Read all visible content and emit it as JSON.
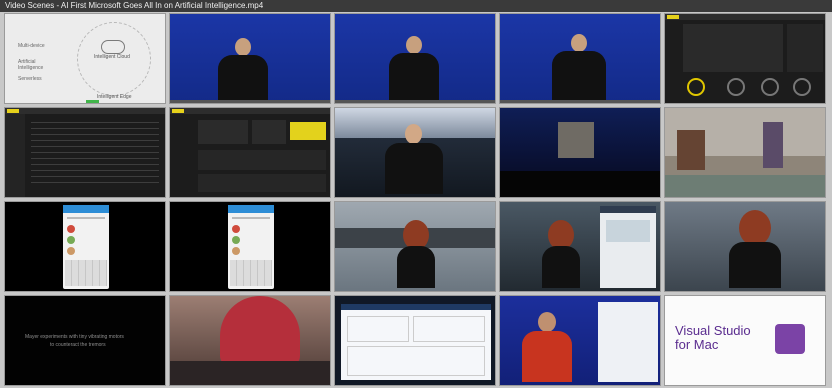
{
  "window": {
    "title": "Video Scenes - AI First Microsoft Goes All In on Artificial Intelligence.mp4"
  },
  "scenes": [
    {
      "kind": "diagram-slide",
      "labels": [
        "Multi-device",
        "Artificial Intelligence",
        "Serverless",
        "Intelligent Cloud",
        "Intelligent Edge"
      ]
    },
    {
      "kind": "speaker-blue"
    },
    {
      "kind": "speaker-blue"
    },
    {
      "kind": "speaker-blue"
    },
    {
      "kind": "dashboard-map"
    },
    {
      "kind": "dashboard-list"
    },
    {
      "kind": "dashboard-charts"
    },
    {
      "kind": "speaker-stage"
    },
    {
      "kind": "stage-wide"
    },
    {
      "kind": "factory-camera"
    },
    {
      "kind": "phone-app"
    },
    {
      "kind": "phone-app"
    },
    {
      "kind": "speaker-woman-kitchen"
    },
    {
      "kind": "speaker-woman-screen"
    },
    {
      "kind": "speaker-woman-closeup"
    },
    {
      "kind": "caption-slide",
      "caption": [
        "Mayer experiments with tiny vibrating motors",
        "to counteract the tremors"
      ]
    },
    {
      "kind": "person-redhair"
    },
    {
      "kind": "azure-dashboard"
    },
    {
      "kind": "speaker-red-shirt"
    },
    {
      "kind": "vs-slide",
      "title": [
        "Visual Studio",
        "for Mac"
      ]
    }
  ]
}
